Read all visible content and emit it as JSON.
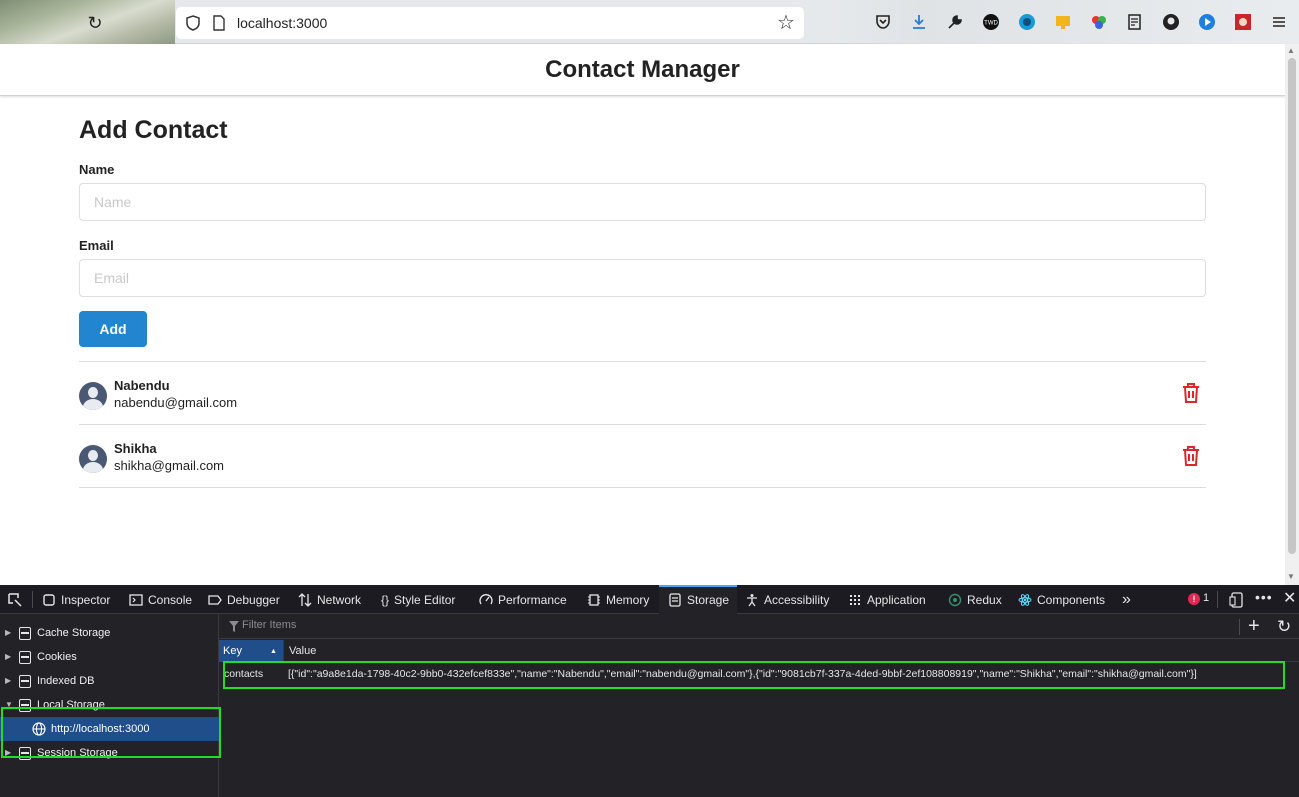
{
  "browser": {
    "url": "localhost:3000"
  },
  "app": {
    "title": "Contact Manager",
    "form": {
      "heading": "Add Contact",
      "name_label": "Name",
      "name_placeholder": "Name",
      "email_label": "Email",
      "email_placeholder": "Email",
      "add_label": "Add"
    },
    "contacts": [
      {
        "name": "Nabendu",
        "email": "nabendu@gmail.com"
      },
      {
        "name": "Shikha",
        "email": "shikha@gmail.com"
      }
    ]
  },
  "devtools": {
    "tabs": [
      "Inspector",
      "Console",
      "Debugger",
      "Network",
      "Style Editor",
      "Performance",
      "Memory",
      "Storage",
      "Accessibility",
      "Application",
      "Redux",
      "Components"
    ],
    "selected_tab": "Storage",
    "error_count": "1",
    "sidebar": {
      "cache_storage": "Cache Storage",
      "cookies": "Cookies",
      "indexed_db": "Indexed DB",
      "local_storage": "Local Storage",
      "local_storage_host": "http://localhost:3000",
      "session_storage": "Session Storage"
    },
    "filter_placeholder": "Filter Items",
    "table": {
      "key_header": "Key",
      "value_header": "Value",
      "row_key": "contacts",
      "row_value": "[{\"id\":\"a9a8e1da-1798-40c2-9bb0-432efcef833e\",\"name\":\"Nabendu\",\"email\":\"nabendu@gmail.com\"},{\"id\":\"9081cb7f-337a-4ded-9bbf-2ef108808919\",\"name\":\"Shikha\",\"email\":\"shikha@gmail.com\"}]"
    }
  },
  "colors": {
    "primary_button": "#2185d0",
    "delete_icon": "#db2828",
    "highlight": "#22dd22",
    "devtools_selected": "#204e8a"
  }
}
